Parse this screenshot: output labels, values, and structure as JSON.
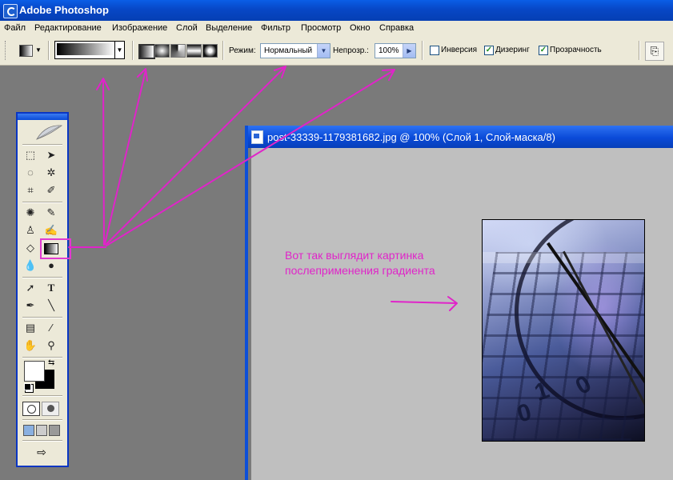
{
  "window": {
    "title": "Adobe Photoshop"
  },
  "menu": [
    "Файл",
    "Редактирование",
    "Изображение",
    "Слой",
    "Выделение",
    "Фильтр",
    "Просмотр",
    "Окно",
    "Справка"
  ],
  "options": {
    "mode_label": "Режим:",
    "mode_value": "Нормальный",
    "opacity_label": "Непрозр.:",
    "opacity_value": "100%",
    "reverse_label": "Инверсия",
    "reverse_checked": false,
    "dither_label": "Дизеринг",
    "dither_checked": true,
    "transparency_label": "Прозрачность",
    "transparency_checked": true,
    "check_glyph": "✓"
  },
  "document": {
    "title": "post-33339-1179381682.jpg @ 100% (Слой 1, Слой-маска/8)"
  },
  "annotation": {
    "line1": "Вот так выглядит картинка",
    "line2": "послеприменения градиента",
    "color": "#e024c9"
  },
  "photo": {
    "digits": [
      "0",
      "1",
      "0"
    ]
  },
  "colors": {
    "titlebar": "#0747c6",
    "panel": "#ece9d8",
    "workspace": "#7a7a7a",
    "canvas": "#bfbfbf"
  }
}
